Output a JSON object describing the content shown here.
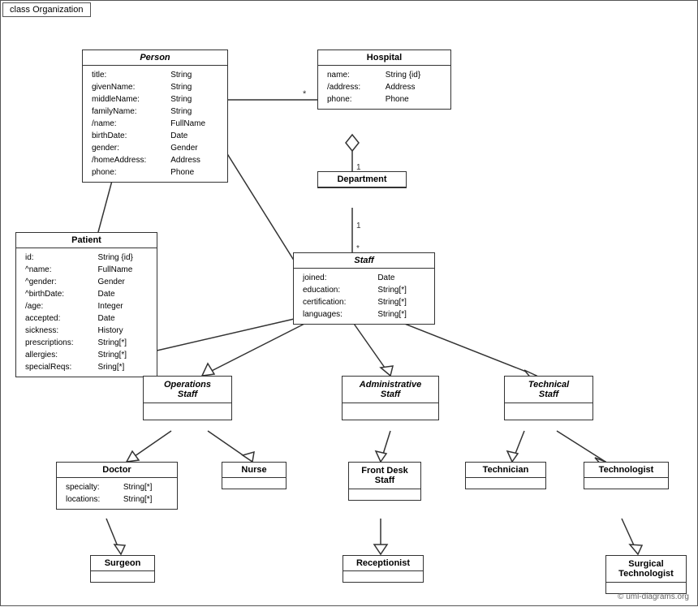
{
  "diagram": {
    "title": "class Organization",
    "copyright": "© uml-diagrams.org",
    "classes": {
      "person": {
        "name": "Person",
        "italic": true,
        "attributes": [
          {
            "name": "title:",
            "type": "String"
          },
          {
            "name": "givenName:",
            "type": "String"
          },
          {
            "name": "middleName:",
            "type": "String"
          },
          {
            "name": "familyName:",
            "type": "String"
          },
          {
            "name": "/name:",
            "type": "FullName"
          },
          {
            "name": "birthDate:",
            "type": "Date"
          },
          {
            "name": "gender:",
            "type": "Gender"
          },
          {
            "name": "/homeAddress:",
            "type": "Address"
          },
          {
            "name": "phone:",
            "type": "Phone"
          }
        ]
      },
      "hospital": {
        "name": "Hospital",
        "italic": false,
        "attributes": [
          {
            "name": "name:",
            "type": "String {id}"
          },
          {
            "name": "/address:",
            "type": "Address"
          },
          {
            "name": "phone:",
            "type": "Phone"
          }
        ]
      },
      "department": {
        "name": "Department",
        "italic": false,
        "attributes": []
      },
      "patient": {
        "name": "Patient",
        "italic": false,
        "attributes": [
          {
            "name": "id:",
            "type": "String {id}"
          },
          {
            "name": "^name:",
            "type": "FullName"
          },
          {
            "name": "^gender:",
            "type": "Gender"
          },
          {
            "name": "^birthDate:",
            "type": "Date"
          },
          {
            "name": "/age:",
            "type": "Integer"
          },
          {
            "name": "accepted:",
            "type": "Date"
          },
          {
            "name": "sickness:",
            "type": "History"
          },
          {
            "name": "prescriptions:",
            "type": "String[*]"
          },
          {
            "name": "allergies:",
            "type": "String[*]"
          },
          {
            "name": "specialReqs:",
            "type": "Sring[*]"
          }
        ]
      },
      "staff": {
        "name": "Staff",
        "italic": true,
        "attributes": [
          {
            "name": "joined:",
            "type": "Date"
          },
          {
            "name": "education:",
            "type": "String[*]"
          },
          {
            "name": "certification:",
            "type": "String[*]"
          },
          {
            "name": "languages:",
            "type": "String[*]"
          }
        ]
      },
      "operations_staff": {
        "name": "Operations\nStaff",
        "italic": true
      },
      "administrative_staff": {
        "name": "Administrative\nStaff",
        "italic": true
      },
      "technical_staff": {
        "name": "Technical\nStaff",
        "italic": true
      },
      "doctor": {
        "name": "Doctor",
        "attributes": [
          {
            "name": "specialty:",
            "type": "String[*]"
          },
          {
            "name": "locations:",
            "type": "String[*]"
          }
        ]
      },
      "nurse": {
        "name": "Nurse"
      },
      "front_desk_staff": {
        "name": "Front Desk\nStaff"
      },
      "technician": {
        "name": "Technician"
      },
      "technologist": {
        "name": "Technologist"
      },
      "surgeon": {
        "name": "Surgeon"
      },
      "receptionist": {
        "name": "Receptionist"
      },
      "surgical_technologist": {
        "name": "Surgical\nTechnologist"
      }
    },
    "multiplicities": {
      "star1": "*",
      "star2": "*",
      "one1": "1",
      "one2": "1",
      "star3": "*",
      "star4": "*",
      "star5": "*"
    }
  }
}
